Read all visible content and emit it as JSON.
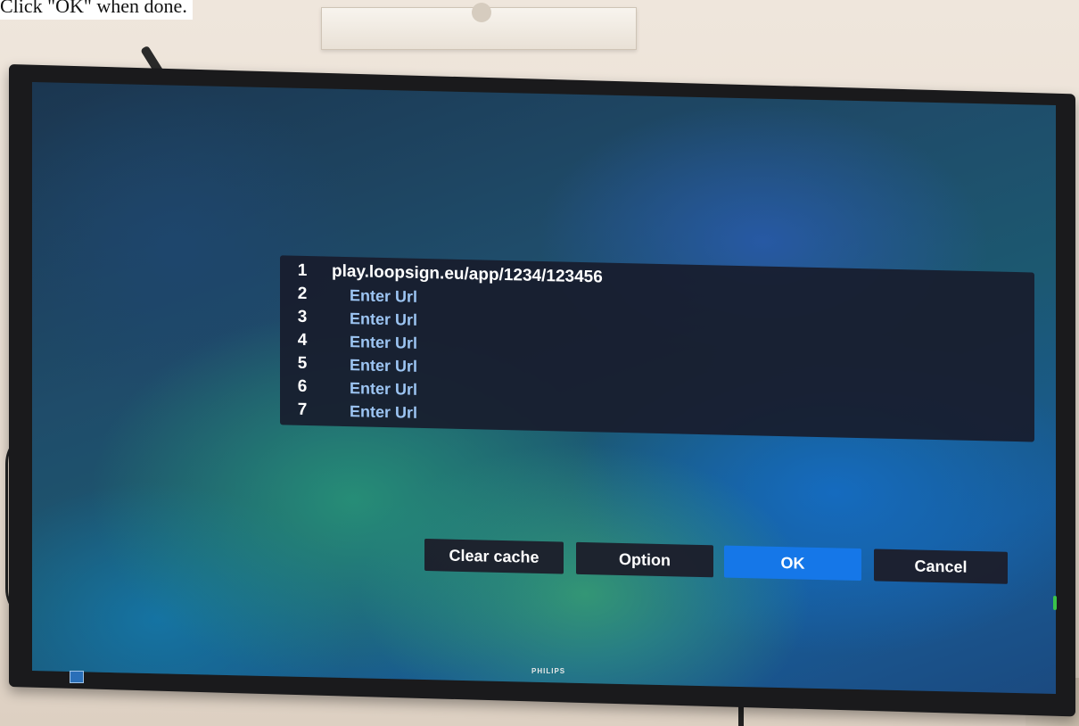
{
  "caption": "Click \"OK\" when done.",
  "url_list": [
    {
      "num": "1",
      "value": "play.loopsign.eu/app/1234/123456",
      "filled": true
    },
    {
      "num": "2",
      "value": "Enter Url",
      "filled": false
    },
    {
      "num": "3",
      "value": "Enter Url",
      "filled": false
    },
    {
      "num": "4",
      "value": "Enter Url",
      "filled": false
    },
    {
      "num": "5",
      "value": "Enter Url",
      "filled": false
    },
    {
      "num": "6",
      "value": "Enter Url",
      "filled": false
    },
    {
      "num": "7",
      "value": "Enter Url",
      "filled": false
    }
  ],
  "buttons": {
    "clear_cache": "Clear cache",
    "option": "Option",
    "ok": "OK",
    "cancel": "Cancel"
  },
  "monitor": {
    "brand": "PHILIPS"
  },
  "colors": {
    "ok_button": "#1577e8",
    "placeholder_text": "#9cc4f2",
    "panel_bg": "#181c2c"
  }
}
